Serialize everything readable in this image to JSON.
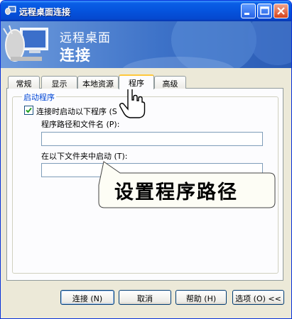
{
  "window": {
    "title": "远程桌面连接"
  },
  "banner": {
    "line1": "远程桌面",
    "line2": "连接"
  },
  "tabs": [
    {
      "label": "常规"
    },
    {
      "label": "显示"
    },
    {
      "label": "本地资源"
    },
    {
      "label": "程序"
    },
    {
      "label": "高级"
    }
  ],
  "active_tab": "程序",
  "group": {
    "label": "启动程序",
    "checkbox_label": "连接时启动以下程序 (S",
    "checkbox_checked": true,
    "path_label": "程序路径和文件名 (P):",
    "path_value": "",
    "folder_label": "在以下文件夹中启动 (T):",
    "folder_value": ""
  },
  "callout": {
    "text": "设置程序路径"
  },
  "buttons": {
    "connect": "连接 (N)",
    "cancel": "取消",
    "help": "帮助 (H)",
    "options": "选项 (O) <<"
  },
  "colors": {
    "accent": "#0046d5",
    "tab_highlight": "#ffc83c",
    "titlebar": "#0553dd"
  },
  "icons": {
    "app": "remote-desktop-icon",
    "cursor": "hand-pointer-icon"
  }
}
